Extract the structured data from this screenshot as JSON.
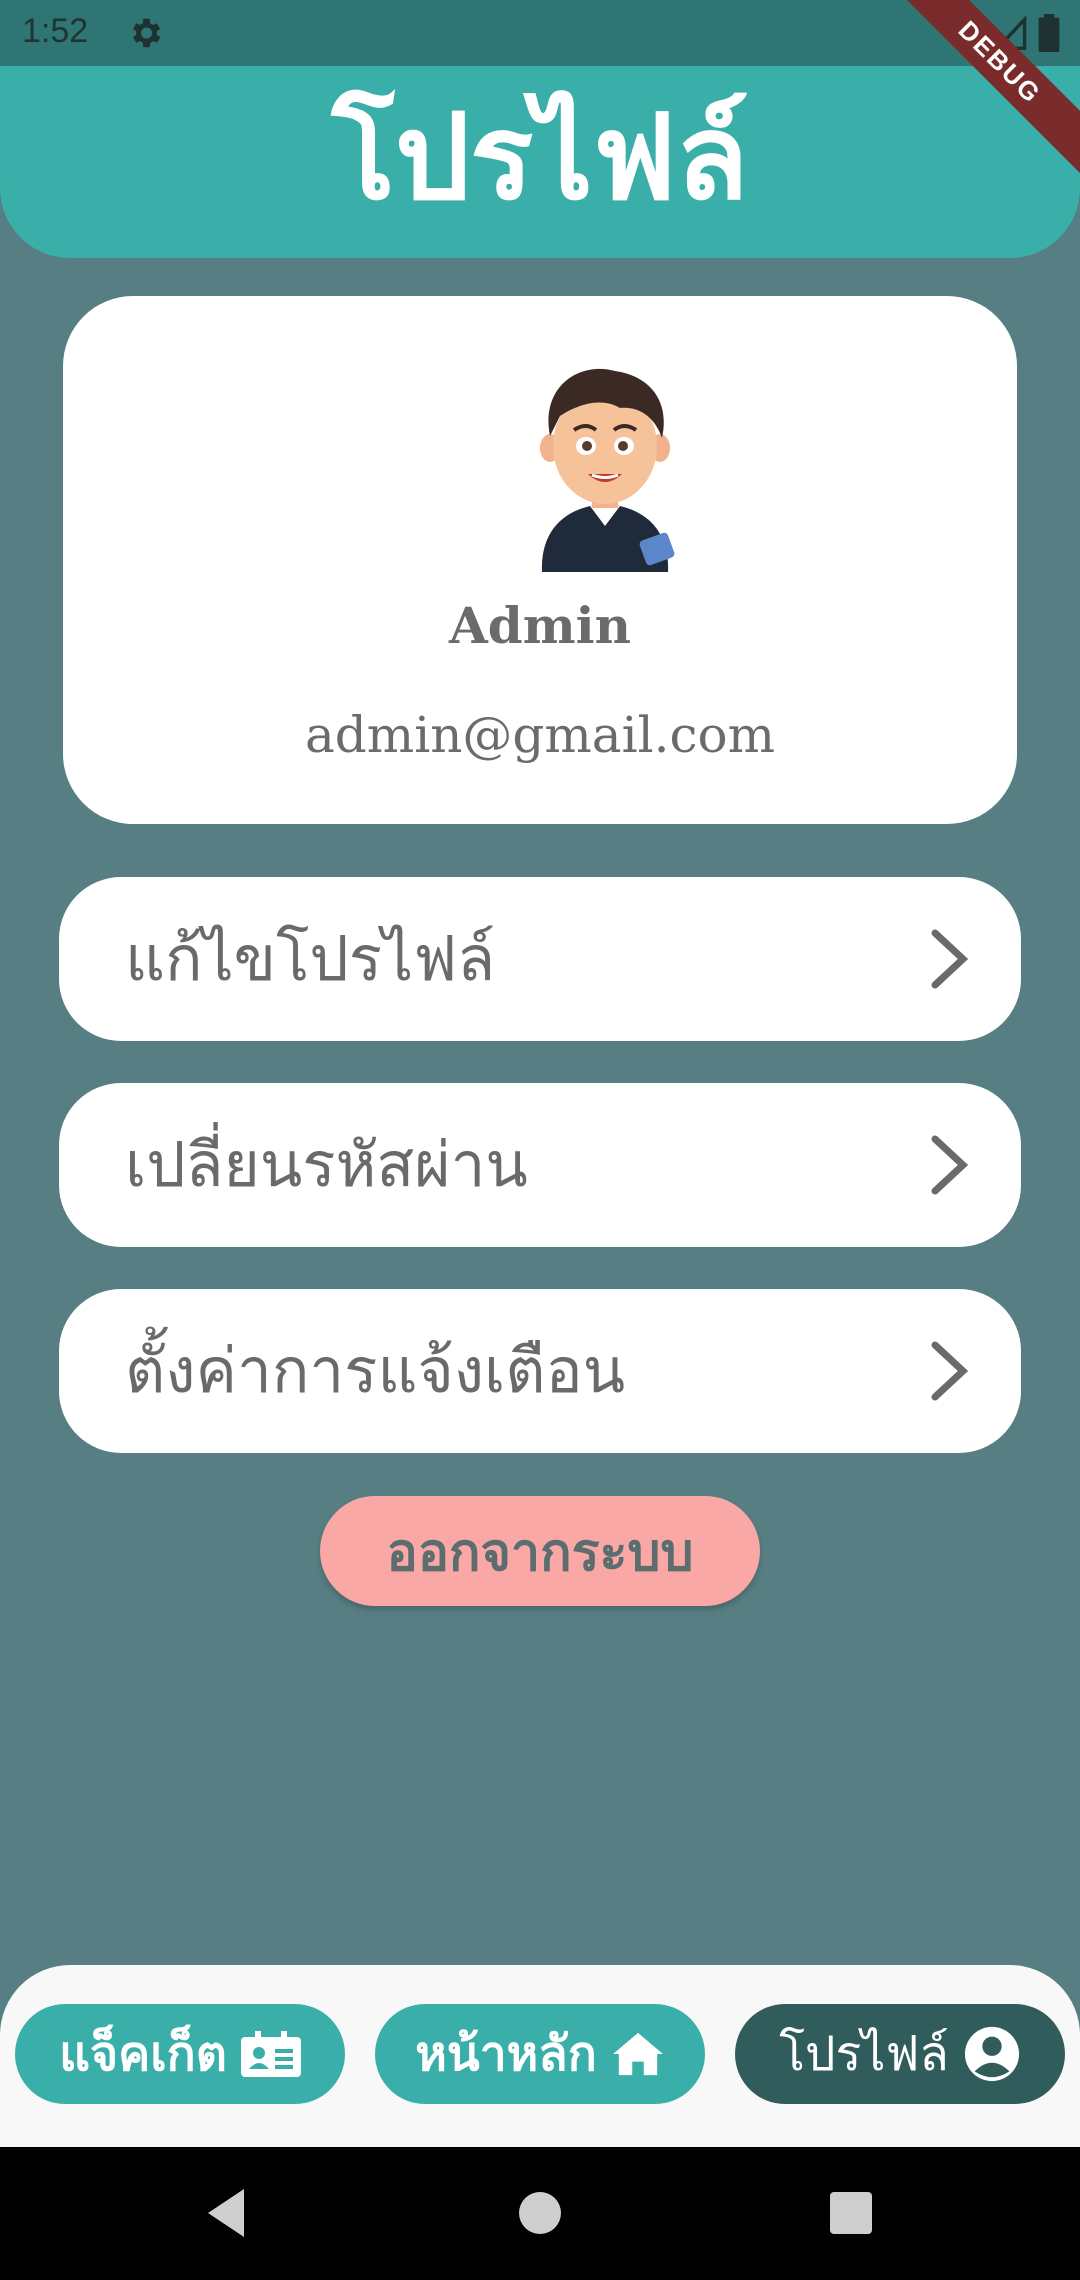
{
  "status_bar": {
    "time": "1:52"
  },
  "debug_banner": "DEBUG",
  "header": {
    "title": "โปรไฟล์"
  },
  "profile": {
    "name": "Admin",
    "email": "admin@gmail.com"
  },
  "menu": {
    "items": [
      {
        "label": "แก้ไขโปรไฟล์"
      },
      {
        "label": "เปลี่ยนรหัสผ่าน"
      },
      {
        "label": "ตั้งค่าการแจ้งเตือน"
      }
    ]
  },
  "logout": {
    "label": "ออกจากระบบ"
  },
  "bottom_nav": {
    "items": [
      {
        "label": "แจ็คเก็ต",
        "icon": "id-card-icon",
        "active": false
      },
      {
        "label": "หน้าหลัก",
        "icon": "home-icon",
        "active": false
      },
      {
        "label": "โปรไฟล์",
        "icon": "user-circle-icon",
        "active": true
      }
    ]
  },
  "colors": {
    "background": "#577E83",
    "header": "#3AAFA9",
    "status_bar": "#2F7573",
    "nav_pill": "#3AAFA9",
    "nav_pill_active": "#305D5B",
    "logout": "#F9A8A6",
    "text_gray": "#6A6A6A"
  }
}
